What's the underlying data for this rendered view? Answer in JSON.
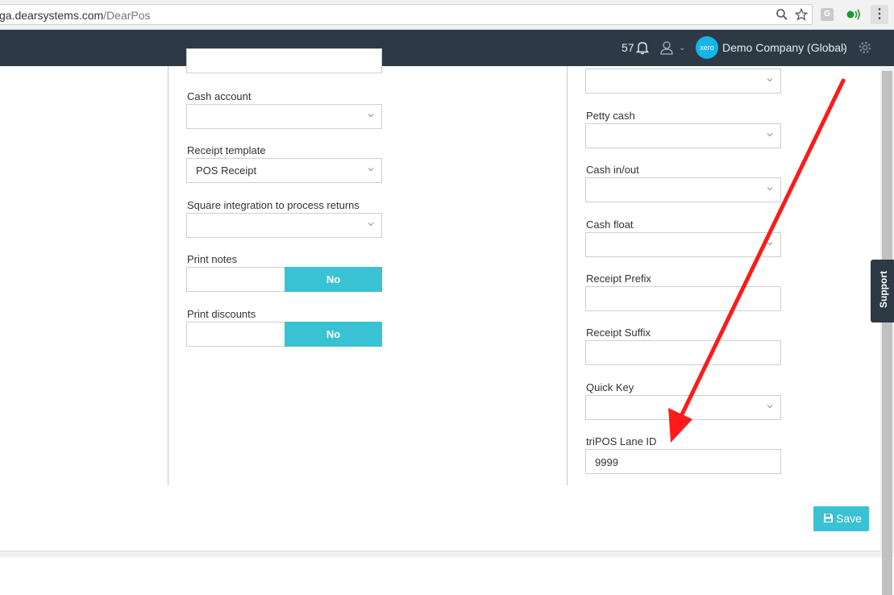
{
  "browser": {
    "url_host": "ga.dearsystems.com",
    "url_path": "/DearPos",
    "extension_label": "G",
    "icons": [
      "search-icon",
      "star-icon",
      "grammarly-icon",
      "green-status-icon",
      "menu-dots-icon"
    ]
  },
  "header": {
    "notification_count": "57",
    "company_name": "Demo Company (Global)",
    "xero_logo_text": "xero",
    "accent_color": "#2d3a46"
  },
  "left_column": {
    "cash_account": {
      "label": "Cash account",
      "value": ""
    },
    "receipt_template": {
      "label": "Receipt template",
      "value": "POS Receipt"
    },
    "square_integration": {
      "label": "Square integration to process returns",
      "value": ""
    },
    "print_notes": {
      "label": "Print notes",
      "toggle_value": "No"
    },
    "print_discounts": {
      "label": "Print discounts",
      "toggle_value": "No"
    }
  },
  "right_column": {
    "petty_cash": {
      "label": "Petty cash",
      "value": ""
    },
    "cash_in_out": {
      "label": "Cash in/out",
      "value": ""
    },
    "cash_float": {
      "label": "Cash float",
      "value": ""
    },
    "receipt_prefix": {
      "label": "Receipt Prefix",
      "value": ""
    },
    "receipt_suffix": {
      "label": "Receipt Suffix",
      "value": ""
    },
    "quick_key": {
      "label": "Quick Key",
      "value": ""
    },
    "tripos_lane_id": {
      "label": "triPOS Lane ID",
      "value": "9999"
    }
  },
  "actions": {
    "save_label": "Save"
  },
  "support_tab": {
    "label": "Support"
  },
  "colors": {
    "toggle_active": "#39c2d3",
    "annotation_arrow": "#ff1a1a"
  }
}
